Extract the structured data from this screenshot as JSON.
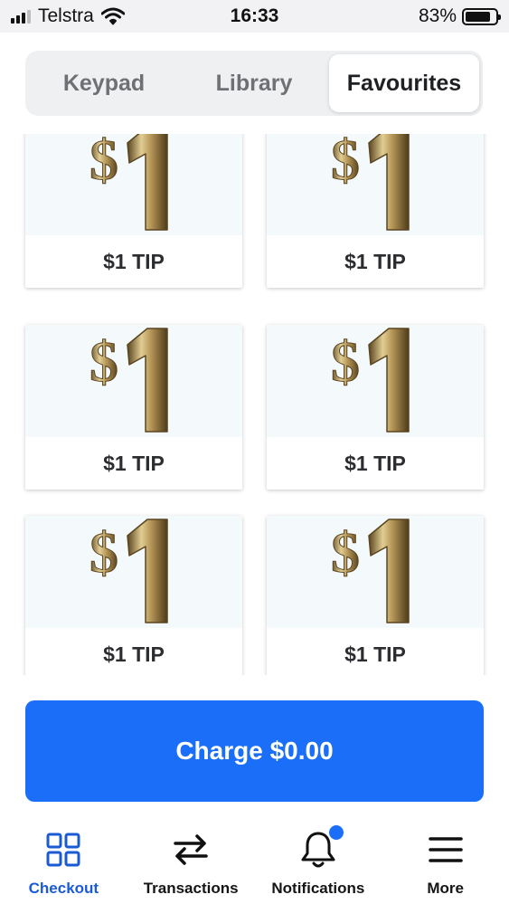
{
  "status_bar": {
    "carrier": "Telstra",
    "time": "16:33",
    "battery_percent_text": "83%",
    "battery_level": 0.83
  },
  "tabs": [
    {
      "label": "Keypad",
      "active": false
    },
    {
      "label": "Library",
      "active": false
    },
    {
      "label": "Favourites",
      "active": true
    }
  ],
  "favourites": [
    {
      "label": "$1 TIP",
      "image_icon": "gold-dollar-one-icon"
    },
    {
      "label": "$1 TIP",
      "image_icon": "gold-dollar-one-icon"
    },
    {
      "label": "$1 TIP",
      "image_icon": "gold-dollar-one-icon"
    },
    {
      "label": "$1 TIP",
      "image_icon": "gold-dollar-one-icon"
    },
    {
      "label": "$1 TIP",
      "image_icon": "gold-dollar-one-icon"
    },
    {
      "label": "$1 TIP",
      "image_icon": "gold-dollar-one-icon"
    }
  ],
  "charge_button": {
    "label": "Charge $0.00",
    "color": "#1a6ef7"
  },
  "bottom_nav": [
    {
      "label": "Checkout",
      "icon": "grid-icon",
      "active": true
    },
    {
      "label": "Transactions",
      "icon": "swap-arrows-icon",
      "active": false
    },
    {
      "label": "Notifications",
      "icon": "bell-icon",
      "active": false,
      "has_badge": true
    },
    {
      "label": "More",
      "icon": "menu-icon",
      "active": false
    }
  ],
  "colors": {
    "accent": "#1a6ef7",
    "active_nav": "#1a5bd4",
    "gold": "#a8884a"
  }
}
